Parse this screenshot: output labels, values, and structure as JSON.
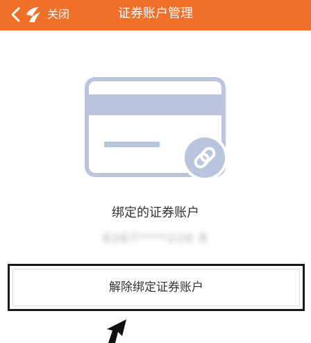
{
  "header": {
    "close_label": "关闭",
    "title": "证券账户管理",
    "background_color": "#f0702a",
    "text_color": "#ffffff"
  },
  "icons": {
    "back": "chevron-left-icon",
    "logo": "app-logo-icon",
    "card": "card-icon",
    "link": "link-icon",
    "cursor": "cursor-arrow-icon"
  },
  "content": {
    "bound_label": "绑定的证券账户",
    "account_number": "0267****220 8",
    "illustration_color": "#b9c4dd"
  },
  "actions": {
    "unbind_label": "解除绑定证券账户"
  }
}
